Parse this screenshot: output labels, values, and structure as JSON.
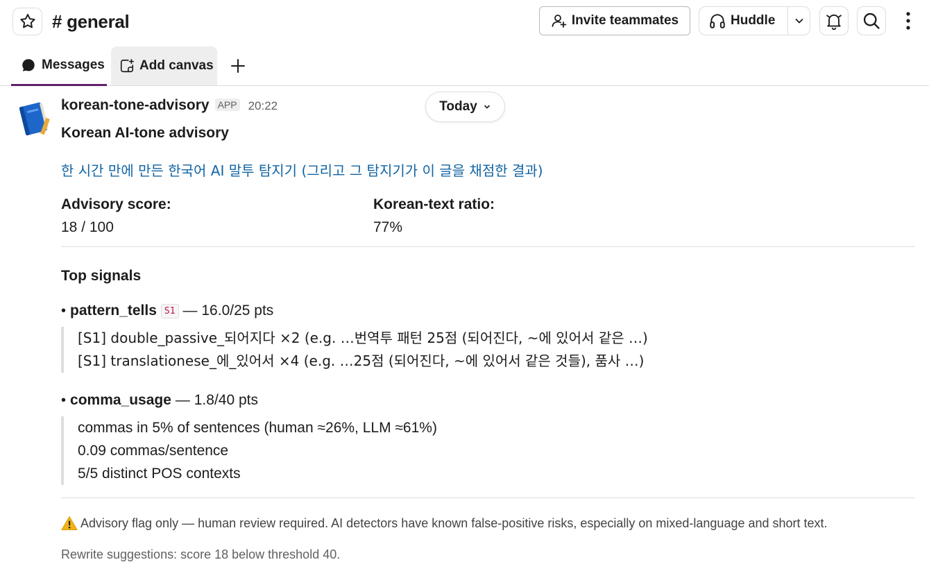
{
  "header": {
    "channel_name": "# general",
    "invite_label": "Invite teammates",
    "huddle_label": "Huddle"
  },
  "tabs": [
    {
      "label": "Messages"
    },
    {
      "label": "Add canvas"
    }
  ],
  "message": {
    "sender": "korean-tone-advisory",
    "badge": "APP",
    "time": "20:22",
    "date_pill": "Today",
    "title": "Korean AI-tone advisory",
    "link_text": "한 시간 만에 만든 한국어 AI 말투 탐지기 (그리고 그 탐지기가 이 글을 채점한 결과)",
    "fields": [
      {
        "label": "Advisory score:",
        "value": "18 / 100"
      },
      {
        "label": "Korean-text ratio:",
        "value": "77%"
      }
    ],
    "section_title": "Top signals",
    "signals": [
      {
        "name": "pattern_tells",
        "tag": "S1",
        "score": "— 16.0/25 pts",
        "details": [
          "[S1] double_passive_되어지다 ×2 (e.g. …번역투 패턴 25점 (되어진다, ~에 있어서 같은 …)",
          "[S1] translationese_에_있어서 ×4 (e.g. …25점 (되어진다, ~에 있어서 같은 것들), 품사 …)"
        ]
      },
      {
        "name": "comma_usage",
        "tag": "",
        "score": "— 1.8/40 pts",
        "details": [
          "commas in 5% of sentences (human ≈26%, LLM ≈61%)",
          "0.09 commas/sentence",
          "5/5 distinct POS contexts"
        ]
      }
    ],
    "disclaimer": "Advisory flag only — human review required. AI detectors have known false-positive risks, especially on mixed-language and short text.",
    "rewrite_note": "Rewrite suggestions: score 18 below threshold 40."
  },
  "colors": {
    "link": "#1264a3",
    "active_tab": "#611f69",
    "code_text": "#c01343"
  }
}
